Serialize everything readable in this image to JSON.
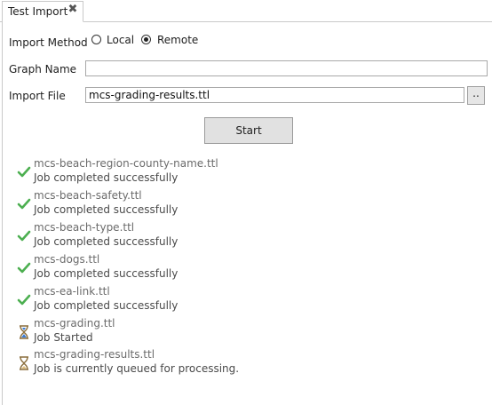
{
  "tab": {
    "title": "Test Import",
    "close_glyph": "✖",
    "close_icon": "close-icon"
  },
  "form": {
    "import_method_label": "Import Method",
    "options": [
      {
        "label": "Local",
        "selected": false
      },
      {
        "label": "Remote",
        "selected": true
      }
    ],
    "graph_name_label": "Graph Name",
    "graph_name_value": "",
    "import_file_label": "Import File",
    "import_file_value": "mcs-grading-results.ttl",
    "browse_label": "..",
    "start_label": "Start"
  },
  "jobs": [
    {
      "name": "mcs-beach-region-county-name.ttl",
      "status": "Job completed successfully",
      "icon": "checkmark-icon",
      "state": "completed"
    },
    {
      "name": "mcs-beach-safety.ttl",
      "status": "Job completed successfully",
      "icon": "checkmark-icon",
      "state": "completed"
    },
    {
      "name": "mcs-beach-type.ttl",
      "status": "Job completed successfully",
      "icon": "checkmark-icon",
      "state": "completed"
    },
    {
      "name": "mcs-dogs.ttl",
      "status": "Job completed successfully",
      "icon": "checkmark-icon",
      "state": "completed"
    },
    {
      "name": "mcs-ea-link.ttl",
      "status": "Job completed successfully",
      "icon": "checkmark-icon",
      "state": "completed"
    },
    {
      "name": "mcs-grading.ttl",
      "status": "Job Started",
      "icon": "hourglass-running-icon",
      "state": "started"
    },
    {
      "name": "mcs-grading-results.ttl",
      "status": "Job is currently queued for processing.",
      "icon": "hourglass-queued-icon",
      "state": "queued"
    }
  ],
  "colors": {
    "check": "#4caf50",
    "hourglass_frame": "#8a6d3b",
    "sand_running": "#3a7bd5",
    "sand_queued": "#e0c080"
  }
}
